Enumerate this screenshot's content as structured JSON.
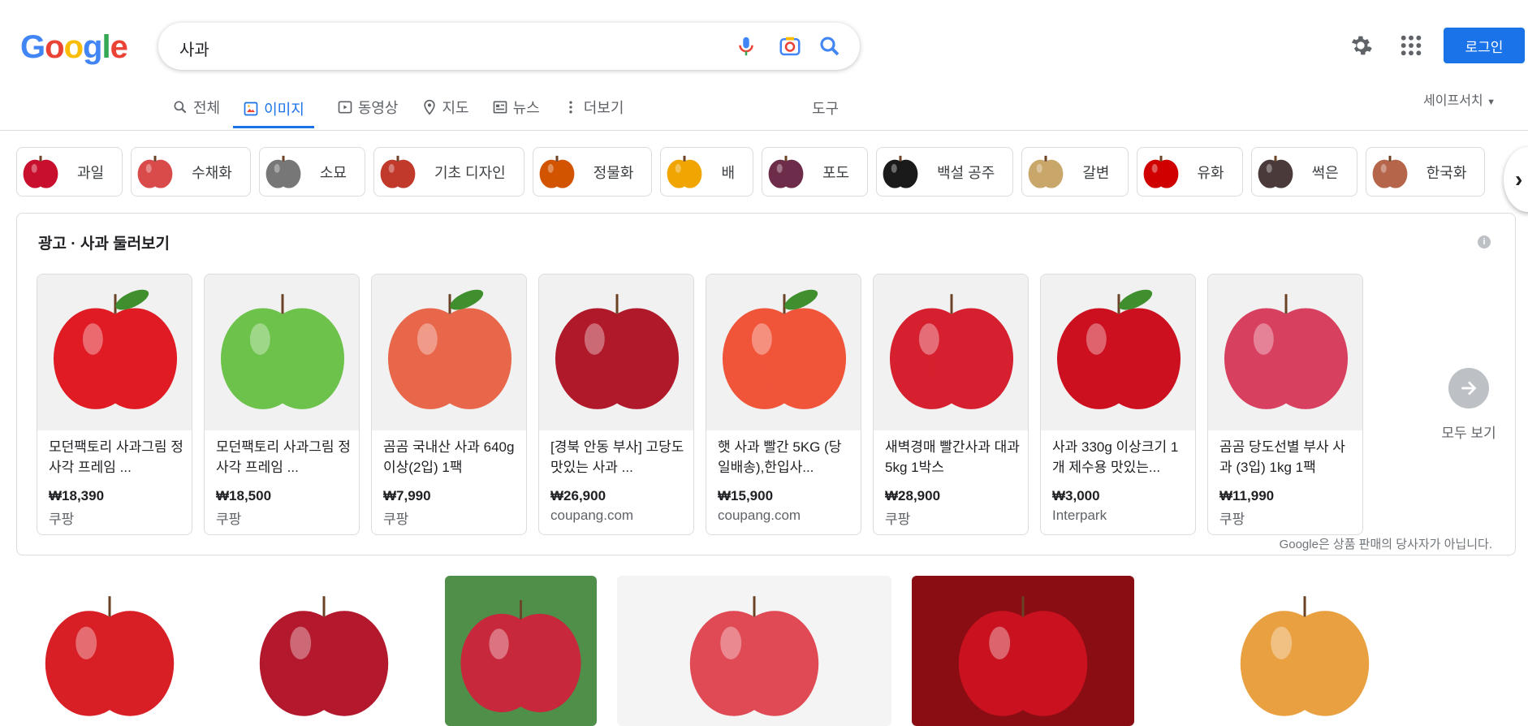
{
  "header": {
    "logo": [
      "G",
      "o",
      "o",
      "g",
      "l",
      "e"
    ],
    "logo_colors": [
      "#4285F4",
      "#EA4335",
      "#FBBC05",
      "#4285F4",
      "#34A853",
      "#EA4335"
    ],
    "query": "사과",
    "login_label": "로그인"
  },
  "tabs": [
    {
      "label": "전체",
      "icon": "search-icon"
    },
    {
      "label": "이미지",
      "icon": "image-icon",
      "active": true
    },
    {
      "label": "동영상",
      "icon": "video-icon"
    },
    {
      "label": "지도",
      "icon": "map-pin-icon"
    },
    {
      "label": "뉴스",
      "icon": "news-icon"
    },
    {
      "label": "더보기",
      "icon": "more-vert-icon"
    }
  ],
  "tools_label": "도구",
  "safesearch_label": "세이프서치",
  "chips": [
    {
      "label": "과일",
      "color": "#c8102e"
    },
    {
      "label": "수채화",
      "color": "#d94a4a"
    },
    {
      "label": "소묘",
      "color": "#777777"
    },
    {
      "label": "기초 디자인",
      "color": "#c0392b"
    },
    {
      "label": "정물화",
      "color": "#d35400"
    },
    {
      "label": "배",
      "color": "#f0a500"
    },
    {
      "label": "포도",
      "color": "#6d2c4a"
    },
    {
      "label": "백설 공주",
      "color": "#1a1a1a"
    },
    {
      "label": "갈변",
      "color": "#c9a76b"
    },
    {
      "label": "유화",
      "color": "#d00000"
    },
    {
      "label": "썩은",
      "color": "#4a3a3a"
    },
    {
      "label": "한국화",
      "color": "#b5654a"
    }
  ],
  "ad": {
    "title": "광고 · 사과 둘러보기",
    "see_all": "모두 보기",
    "footer": "Google은 상품 판매의 당사자가 아닙니다.",
    "cards": [
      {
        "title": "모던팩토리 사과그림 정사각 프레임 ...",
        "price": "₩18,390",
        "seller": "쿠팡",
        "color": "#e01b24"
      },
      {
        "title": "모던팩토리 사과그림 정사각 프레임 ...",
        "price": "₩18,500",
        "seller": "쿠팡",
        "color": "#6cc24a"
      },
      {
        "title": "곰곰 국내산 사과 640g이상(2입) 1팩",
        "price": "₩7,990",
        "seller": "쿠팡",
        "color": "#e8664a"
      },
      {
        "title": "[경북 안동 부사] 고당도 맛있는 사과 ...",
        "price": "₩26,900",
        "seller": "coupang.com",
        "color": "#b0192a"
      },
      {
        "title": "햇 사과 빨간 5KG (당일배송),한입사...",
        "price": "₩15,900",
        "seller": "coupang.com",
        "color": "#f0553a"
      },
      {
        "title": "새벽경매 빨간사과 대과 5kg 1박스",
        "price": "₩28,900",
        "seller": "쿠팡",
        "color": "#d6202f"
      },
      {
        "title": "사과 330g 이상크기 1개 제수용 맛있는...",
        "price": "₩3,000",
        "seller": "Interpark",
        "color": "#cc1020"
      },
      {
        "title": "곰곰 당도선별 부사 사과 (3입) 1kg 1팩",
        "price": "₩11,990",
        "seller": "쿠팡",
        "color": "#d84060"
      }
    ]
  },
  "results": [
    {
      "color": "#d81f26",
      "bg": "#ffffff"
    },
    {
      "color": "#b3182d",
      "bg": "#ffffff"
    },
    {
      "color": "#c8283c",
      "bg": "#4f8f4a"
    },
    {
      "color": "#e04a55",
      "bg": "#f4f4f4"
    },
    {
      "color": "#c9111f",
      "bg": "#8a0d14"
    },
    {
      "color": "#e8a040",
      "bg": "#ffffff"
    }
  ]
}
